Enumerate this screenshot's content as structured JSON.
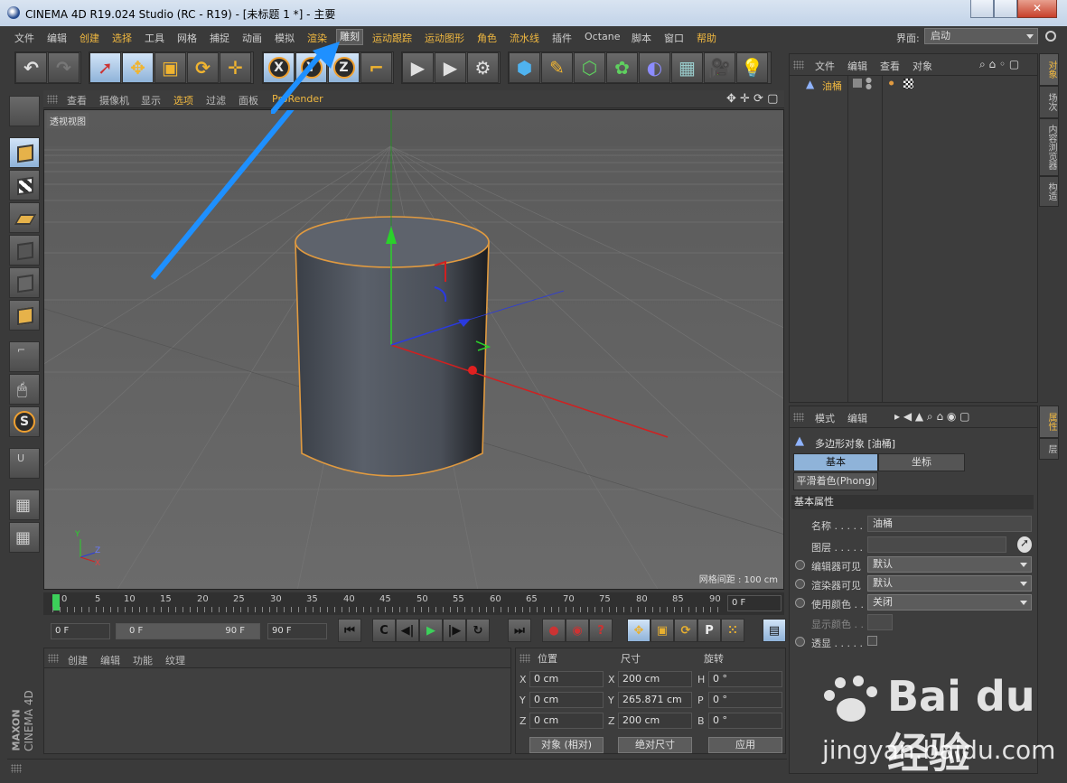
{
  "window": {
    "title": "CINEMA 4D R19.024 Studio (RC - R19) - [未标题 1 *] - 主要"
  },
  "menubar": {
    "items": [
      "文件",
      "编辑",
      "创建",
      "选择",
      "工具",
      "网格",
      "捕捉",
      "动画",
      "模拟",
      "渲染",
      "雕刻",
      "运动跟踪",
      "运动图形",
      "角色",
      "流水线",
      "插件",
      "Octane",
      "脚本",
      "窗口",
      "帮助"
    ],
    "layout_label": "界面:",
    "layout_value": "启动"
  },
  "viewport": {
    "menu": [
      "查看",
      "摄像机",
      "显示",
      "选项",
      "过滤",
      "面板",
      "ProRender"
    ],
    "label": "透视视图",
    "grid_text": "网格间距 : 100 cm",
    "axis": {
      "x": "X",
      "y": "Y",
      "z": "Z"
    }
  },
  "timeline": {
    "ticks": [
      "0",
      "5",
      "10",
      "15",
      "20",
      "25",
      "30",
      "35",
      "40",
      "45",
      "50",
      "55",
      "60",
      "65",
      "70",
      "75",
      "80",
      "85",
      "90"
    ],
    "current_frame": "0 F"
  },
  "transport": {
    "start": "0 F",
    "range_start": "0 F",
    "range_end": "90 F",
    "end": "90 F"
  },
  "material_panel": {
    "menu": [
      "创建",
      "编辑",
      "功能",
      "纹理"
    ]
  },
  "coords": {
    "headers": {
      "position": "位置",
      "size": "尺寸",
      "rotation": "旋转"
    },
    "rows": [
      {
        "axis": "X",
        "pos": "0 cm",
        "size_axis": "X",
        "size": "200 cm",
        "rot_axis": "H",
        "rot": "0 °"
      },
      {
        "axis": "Y",
        "pos": "0 cm",
        "size_axis": "Y",
        "size": "265.871 cm",
        "rot_axis": "P",
        "rot": "0 °"
      },
      {
        "axis": "Z",
        "pos": "0 cm",
        "size_axis": "Z",
        "size": "200 cm",
        "rot_axis": "B",
        "rot": "0 °"
      }
    ],
    "mode_select": "对象 (相对)",
    "size_select": "绝对尺寸",
    "apply": "应用"
  },
  "object_manager": {
    "menu": [
      "文件",
      "编辑",
      "查看",
      "对象"
    ],
    "object_name": "油桶"
  },
  "side_tabs": {
    "top": [
      "对象",
      "场次",
      "内容浏览器",
      "构造"
    ],
    "bottom": [
      "属性",
      "层"
    ]
  },
  "attributes": {
    "menu": [
      "模式",
      "编辑"
    ],
    "title": "多边形对象 [油桶]",
    "tabs": [
      "基本",
      "坐标"
    ],
    "tab2": "平滑着色(Phong)",
    "section": "基本属性",
    "rows": [
      {
        "label": "名称 . . . . .",
        "value": "油桶"
      },
      {
        "label": "图层 . . . . .",
        "value": ""
      },
      {
        "label": "编辑器可见",
        "value": "默认"
      },
      {
        "label": "渲染器可见",
        "value": "默认"
      },
      {
        "label": "使用颜色 . .",
        "value": "关闭"
      },
      {
        "label": "显示颜色 . .",
        "value": ""
      },
      {
        "label": "透显 . . . . .",
        "value": ""
      }
    ]
  },
  "branding": {
    "maxon": "MAXON",
    "cinema": "CINEMA 4D"
  },
  "watermark": {
    "text": "Bai du 经验",
    "url": "jingyan.baidu.com"
  },
  "colors": {
    "accent": "#f0b840",
    "selection": "#8fb3d9",
    "arrow": "#1e90ff"
  }
}
